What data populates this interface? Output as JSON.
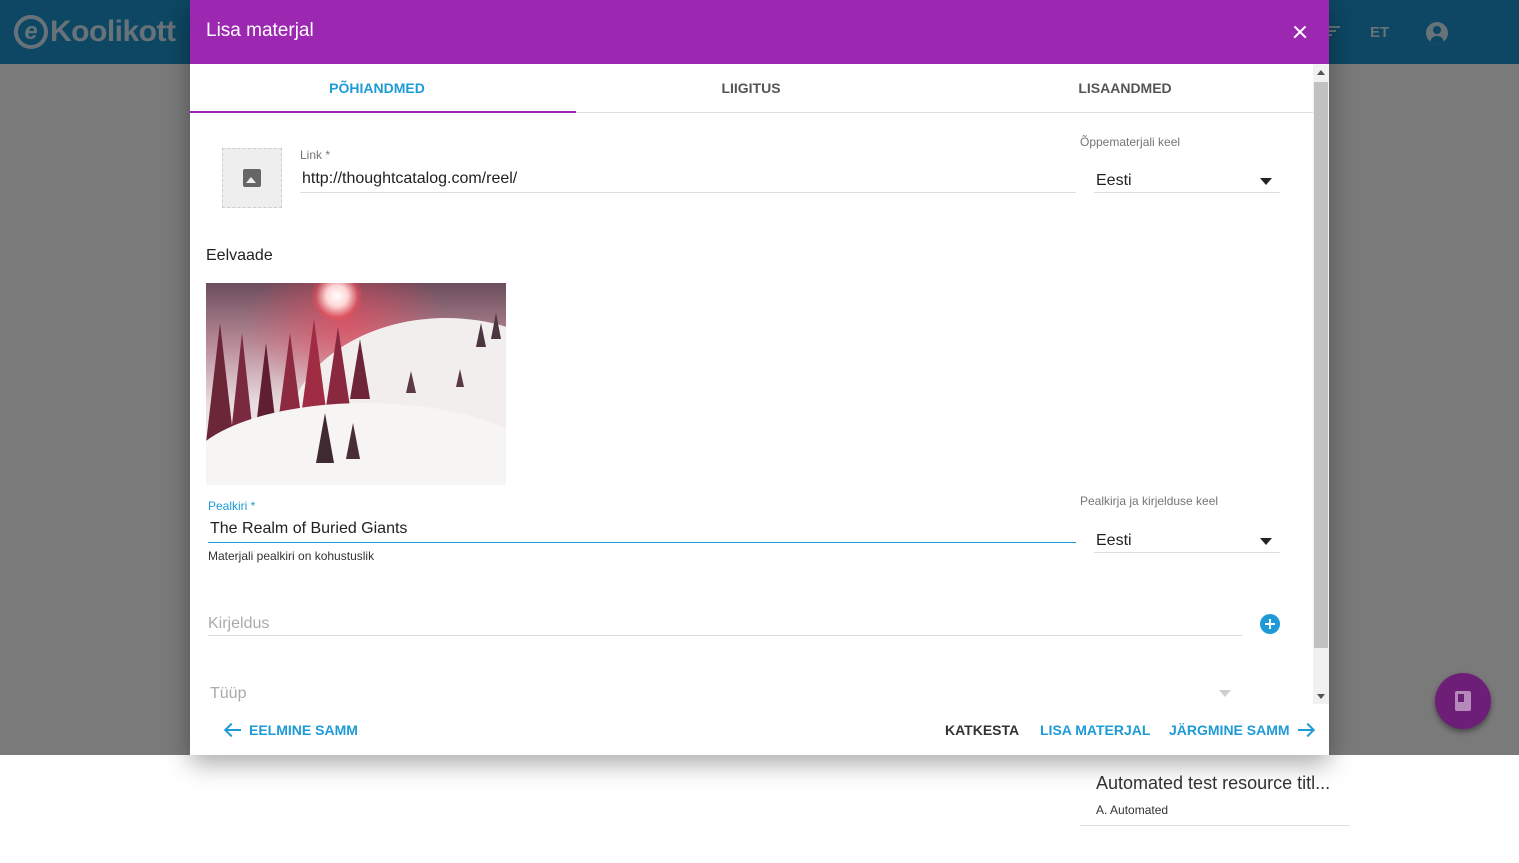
{
  "app": {
    "logo_letter": "e",
    "logo_word": "Koolikott",
    "language": "ET",
    "header_color": "#1a8fc6"
  },
  "background_card": {
    "title": "Automated test resource titl...",
    "author": "A. Automated"
  },
  "dialog": {
    "title": "Lisa materjal",
    "accent_color": "#9c27b0",
    "tabs": [
      {
        "label": "PÕHIANDMED",
        "active": true
      },
      {
        "label": "LIIGITUS",
        "active": false
      },
      {
        "label": "LISAANDMED",
        "active": false
      }
    ],
    "link": {
      "label": "Link *",
      "value": "http://thoughtcatalog.com/reel/"
    },
    "material_language": {
      "label": "Õppematerjali keel",
      "value": "Eesti"
    },
    "preview_title": "Eelvaade",
    "title_field": {
      "label": "Pealkiri *",
      "value": "The Realm of Buried Giants",
      "hint": "Materjali pealkiri on kohustuslik"
    },
    "title_language": {
      "label": "Pealkirja ja kirjelduse keel",
      "value": "Eesti"
    },
    "description": {
      "placeholder": "Kirjeldus"
    },
    "type": {
      "placeholder": "Tüüp"
    },
    "footer": {
      "previous": "EELMINE SAMM",
      "cancel": "KATKESTA",
      "add": "LISA MATERJAL",
      "next": "JÄRGMINE SAMM"
    }
  },
  "icons": {
    "close": "close-icon",
    "image_placeholder": "image-icon",
    "add": "add-circle-icon",
    "arrow_back": "arrow-left-icon",
    "arrow_forward": "arrow-right-icon",
    "fab": "book-icon",
    "account": "account-circle-icon",
    "filter": "filter-icon"
  },
  "link_color": "#1e9bd7"
}
